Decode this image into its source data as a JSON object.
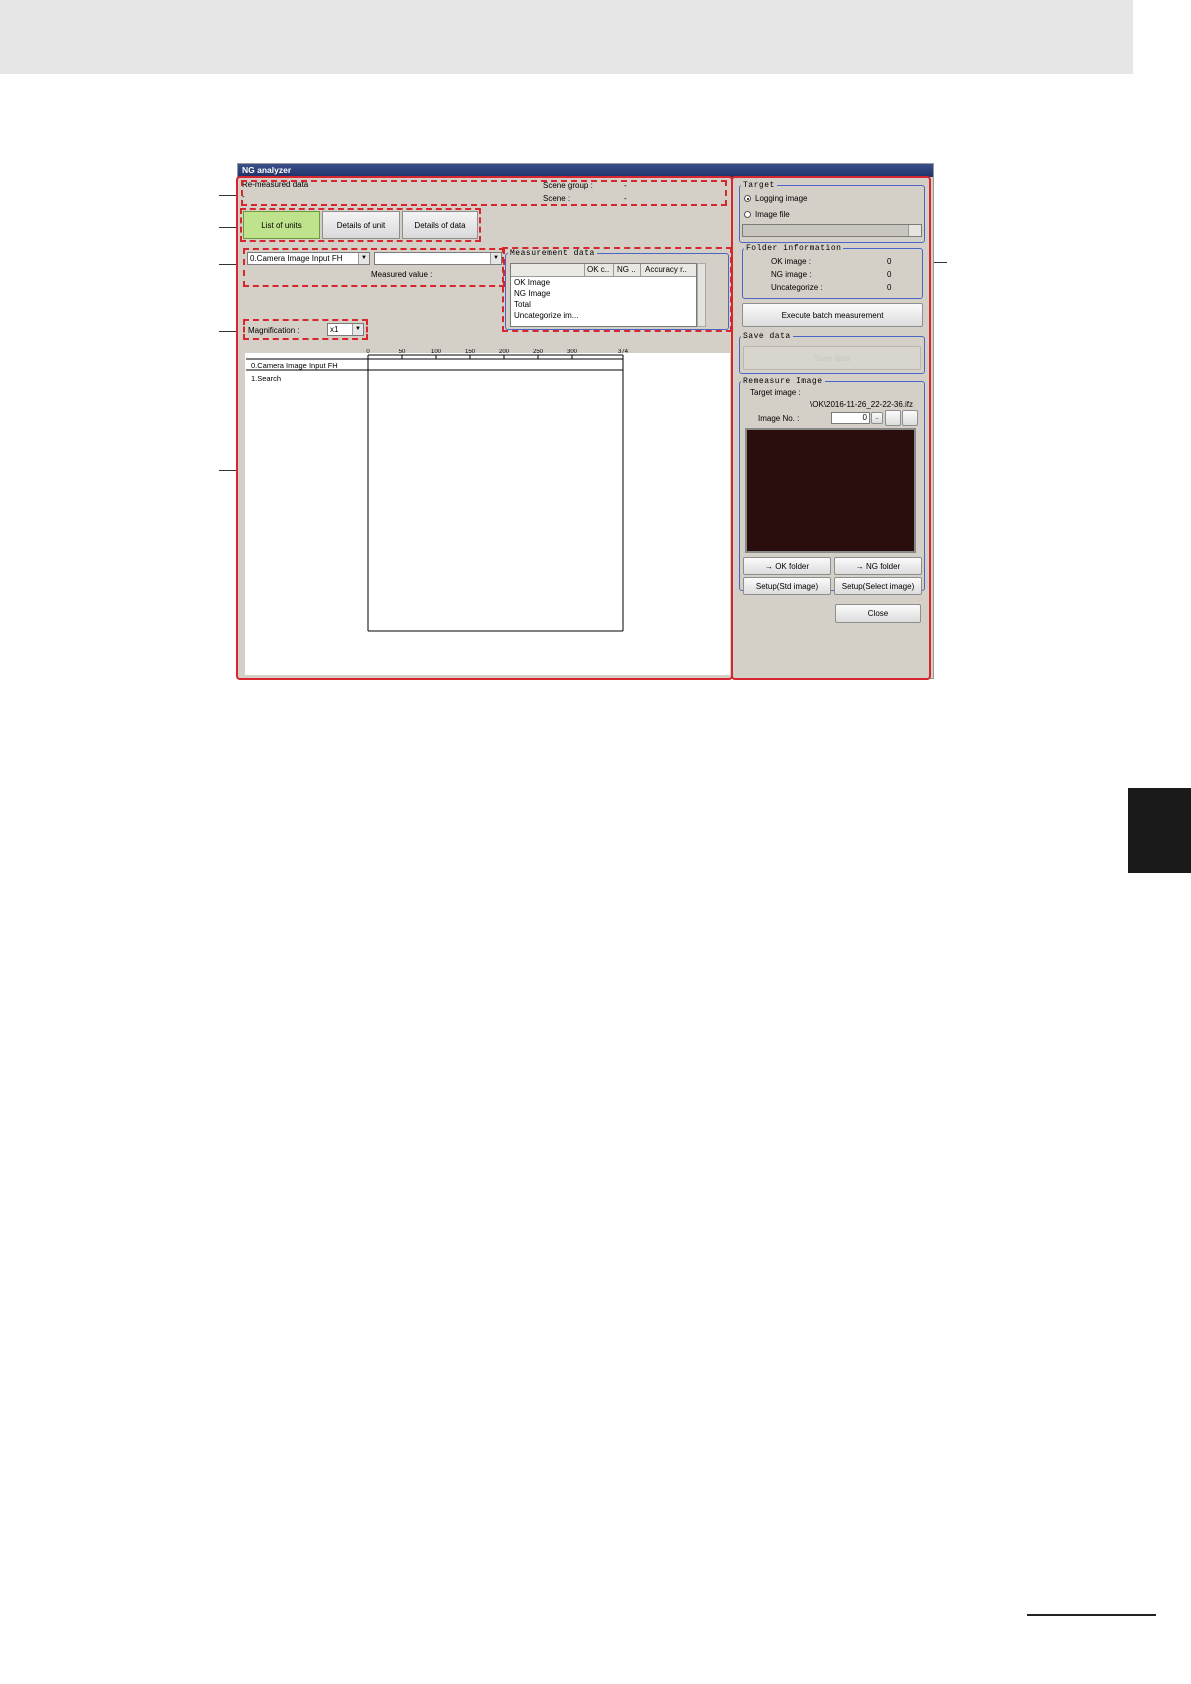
{
  "window": {
    "title": "NG analyzer"
  },
  "header": {
    "remeasured_label": "Re-measured data",
    "remeasured_value": "-",
    "scene_group_label": "Scene group :",
    "scene_group_value": "-",
    "scene_label": "Scene :",
    "scene_value": "-"
  },
  "tabs": [
    {
      "label": "List of units",
      "active": true
    },
    {
      "label": "Details of unit",
      "active": false
    },
    {
      "label": "Details of data",
      "active": false
    }
  ],
  "unit_select": {
    "value": "0.Camera Image Input FH",
    "second_value": ""
  },
  "measured_value_label": "Measured value :",
  "magnification": {
    "label": "Magnification :",
    "value": "x1"
  },
  "measurement_data": {
    "title": "Measurement data",
    "columns": [
      "",
      "OK c..",
      "NG ..",
      "Accuracy r.."
    ],
    "rows": [
      "OK Image",
      "NG Image",
      "Total",
      "Uncategorize im..."
    ]
  },
  "timeline": {
    "ticks": [
      "0",
      "50",
      "100",
      "150",
      "200",
      "250",
      "300",
      "374"
    ],
    "units": [
      "0.Camera Image Input FH",
      "1.Search"
    ]
  },
  "target": {
    "title": "Target",
    "option_logging": "Logging image",
    "option_file": "Image file",
    "selected": "Logging image"
  },
  "folder_info": {
    "title": "Folder information",
    "rows": [
      {
        "label": "OK image :",
        "value": "0"
      },
      {
        "label": "NG image :",
        "value": "0"
      },
      {
        "label": "Uncategorize :",
        "value": "0"
      }
    ]
  },
  "execute_button": "Execute batch measurement",
  "save_data": {
    "title": "Save data",
    "button": "Save data"
  },
  "remeasure": {
    "title": "Remeasure Image",
    "target_label": "Target image :",
    "target_path": "\\OK\\2016-11-26_22-22-36.ifz",
    "image_no_label": "Image No. :",
    "image_no_value": "0",
    "browse": "..",
    "ok_folder": "→ OK folder",
    "ng_folder": "→ NG folder",
    "setup_std": "Setup(Std image)",
    "setup_select": "Setup(Select image)"
  },
  "close_button": "Close",
  "colors": {
    "accent_red": "#d6262e",
    "group_blue": "#4a66c4",
    "active_tab": "#bfe38c",
    "preview": "#2a0d0d"
  }
}
